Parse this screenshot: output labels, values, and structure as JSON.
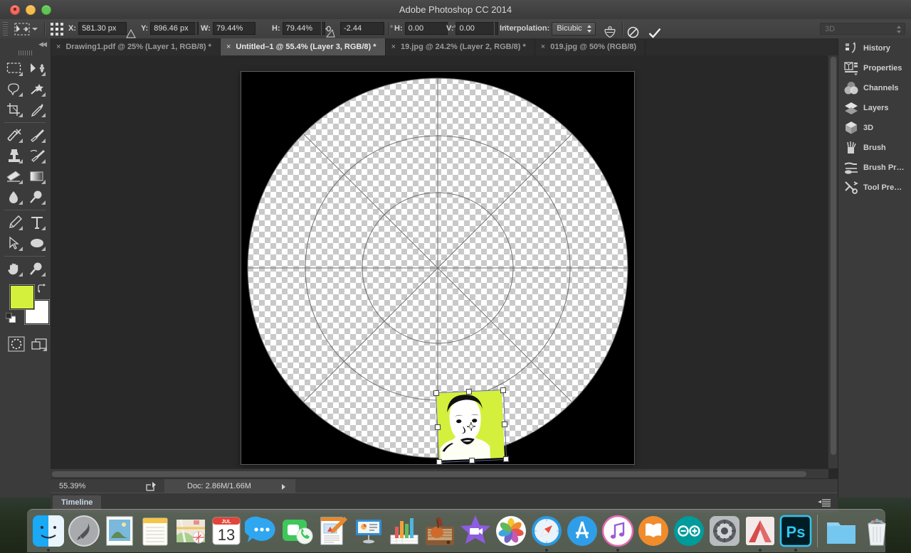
{
  "window": {
    "title": "Adobe Photoshop CC 2014",
    "traffic_lights": [
      "close-button",
      "minimize-button",
      "maximize-button"
    ]
  },
  "options_bar": {
    "tool_icon": "move-tool-icon",
    "reference_grid_icon": "transform-reference-point-icon",
    "fields": [
      {
        "label": "X:",
        "value": "581.30 px"
      },
      {
        "label": "Y:",
        "value": "896.46 px"
      },
      {
        "label": "W:",
        "value": "79.44%"
      },
      {
        "label": "H:",
        "value": "79.44%"
      },
      {
        "label": "",
        "value": "-2.44",
        "suffix": "°"
      },
      {
        "label": "H:",
        "value": "0.00",
        "suffix": "°"
      },
      {
        "label": "V:",
        "value": "0.00",
        "suffix": "°"
      }
    ],
    "triangle_icon": "delta-x-icon",
    "triangle2_icon": "delta-y-icon",
    "link_icon": "maintain-aspect-ratio-icon",
    "skew_icon": "rotate-angle-icon",
    "interpolation_label": "Interpolation:",
    "interpolation_value": "Bicubic",
    "warp_icon": "warp-mode-icon",
    "cancel_icon": "cancel-transform-icon",
    "commit_icon": "commit-transform-icon",
    "mode_3d": "3D"
  },
  "tabs": [
    {
      "label": "Drawing1.pdf @ 25% (Layer 1, RGB/8) *",
      "active": false,
      "close": "×"
    },
    {
      "label": "Untitled–1 @ 55.4% (Layer 3, RGB/8) *",
      "active": true,
      "close": "×"
    },
    {
      "label": "19.jpg @ 24.2% (Layer 2, RGB/8) *",
      "active": false,
      "close": "×"
    },
    {
      "label": "019.jpg @ 50% (RGB/8)",
      "active": false,
      "close": "×"
    }
  ],
  "toolbar": {
    "collapse_icon": "collapse-panel-icon",
    "rows": [
      [
        "rectangular-marquee-tool",
        "move-tool"
      ],
      [
        "lasso-tool",
        "magic-wand-tool"
      ],
      [
        "crop-tool",
        "eyedropper-tool"
      ],
      [
        "spot-healing-brush-tool",
        "brush-tool"
      ],
      [
        "clone-stamp-tool",
        "history-brush-tool"
      ],
      [
        "eraser-tool",
        "gradient-tool"
      ],
      [
        "blur-tool",
        "dodge-tool"
      ],
      [
        "pen-tool",
        "type-tool"
      ],
      [
        "path-selection-tool",
        "ellipse-tool"
      ],
      [
        "hand-tool",
        "zoom-tool"
      ]
    ],
    "foreground_color": "#d4f03c",
    "background_color": "#ffffff",
    "swap_colors_icon": "swap-colors-icon",
    "default_colors_icon": "default-colors-icon",
    "quick_mask_icon": "quick-mask-mode-icon",
    "screen_mode_icon": "screen-mode-icon"
  },
  "document": {
    "zoom": "55.39%",
    "doc_size": "Doc: 2.86M/1.66M",
    "share_icon": "share-icon",
    "status_arrow_icon": "status-expand-icon",
    "canvas_background": "#000000",
    "transform_selection": {
      "handles": 8,
      "reference_point_icon": "transform-center-point-icon",
      "image_fill": "#d4f03c"
    }
  },
  "timeline": {
    "tab_label": "Timeline",
    "panel_menu_icon": "panel-menu-icon"
  },
  "right_dock": {
    "items": [
      {
        "label": "History",
        "icon": "history-panel-icon"
      },
      {
        "label": "Properties",
        "icon": "properties-panel-icon"
      },
      {
        "label": "Channels",
        "icon": "channels-panel-icon"
      },
      {
        "label": "Layers",
        "icon": "layers-panel-icon"
      },
      {
        "label": "3D",
        "icon": "3d-panel-icon"
      },
      {
        "label": "Brush",
        "icon": "brush-panel-icon"
      },
      {
        "label": "Brush Pr…",
        "icon": "brush-presets-panel-icon"
      },
      {
        "label": "Tool Pre…",
        "icon": "tool-presets-panel-icon"
      }
    ]
  },
  "dock": {
    "items": [
      {
        "name": "finder",
        "running": true
      },
      {
        "name": "launchpad",
        "running": false
      },
      {
        "name": "preview",
        "running": false
      },
      {
        "name": "notes",
        "running": false
      },
      {
        "name": "maps",
        "running": false
      },
      {
        "name": "calendar",
        "running": false,
        "month": "JUL",
        "day": "13"
      },
      {
        "name": "messages",
        "running": false
      },
      {
        "name": "facetime",
        "running": false
      },
      {
        "name": "pages",
        "running": false
      },
      {
        "name": "keynote",
        "running": false
      },
      {
        "name": "numbers",
        "running": false
      },
      {
        "name": "garageband",
        "running": false
      },
      {
        "name": "imovie",
        "running": false
      },
      {
        "name": "photos",
        "running": false
      },
      {
        "name": "safari",
        "running": true
      },
      {
        "name": "app-store",
        "running": false
      },
      {
        "name": "itunes",
        "running": true
      },
      {
        "name": "ibooks",
        "running": false
      },
      {
        "name": "arduino",
        "running": false
      },
      {
        "name": "system-preferences",
        "running": false
      },
      {
        "name": "autocad",
        "running": true
      },
      {
        "name": "photoshop",
        "running": true
      },
      {
        "name": "documents-folder",
        "running": false
      },
      {
        "name": "trash",
        "running": false
      }
    ]
  }
}
